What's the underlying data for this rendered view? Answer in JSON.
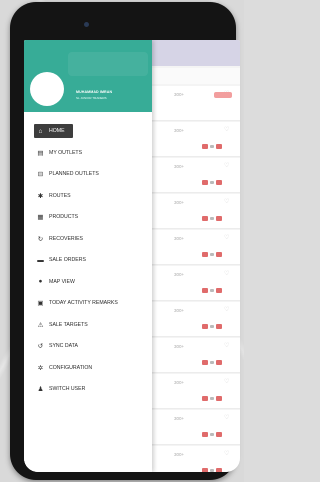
{
  "user": {
    "name": "MUHAMMAD IMRAN",
    "role": "SL JUNIOR TRADERS"
  },
  "menu": [
    {
      "label": "HOME",
      "icon": "home-icon",
      "glyph": "⌂",
      "active": true
    },
    {
      "label": "MY OUTLETS",
      "icon": "store-icon",
      "glyph": "▤",
      "active": false
    },
    {
      "label": "PLANNED OUTLETS",
      "icon": "car-icon",
      "glyph": "⊟",
      "active": false
    },
    {
      "label": "ROUTES",
      "icon": "routes-icon",
      "glyph": "✱",
      "active": false
    },
    {
      "label": "PRODUCTS",
      "icon": "box-icon",
      "glyph": "▦",
      "active": false
    },
    {
      "label": "RECOVERIES",
      "icon": "refresh-icon",
      "glyph": "↻",
      "active": false
    },
    {
      "label": "SALE ORDERS",
      "icon": "list-icon",
      "glyph": "▬",
      "active": false
    },
    {
      "label": "MAP VIEW",
      "icon": "map-pin-icon",
      "glyph": "●",
      "active": false
    },
    {
      "label": "TODAY ACTIVITY REMARKS",
      "icon": "clipboard-icon",
      "glyph": "▣",
      "active": false
    },
    {
      "label": "SALE TARGETS",
      "icon": "target-icon",
      "glyph": "⚠",
      "active": false
    },
    {
      "label": "SYNC DATA",
      "icon": "sync-icon",
      "glyph": "↺",
      "active": false
    },
    {
      "label": "CONFIGURATION",
      "icon": "gear-icon",
      "glyph": "✲",
      "active": false
    },
    {
      "label": "SWITCH USER",
      "icon": "user-icon",
      "glyph": "♟",
      "active": false
    }
  ],
  "background_rows": [
    {
      "amount": "300+",
      "badge": "pink"
    },
    {
      "amount": "300+",
      "badge": "tags"
    },
    {
      "amount": "300+",
      "badge": "tags"
    },
    {
      "amount": "300+",
      "badge": "tags"
    },
    {
      "amount": "300+",
      "badge": "tags"
    },
    {
      "amount": "300+",
      "badge": "tags"
    },
    {
      "amount": "300+",
      "badge": "tags"
    },
    {
      "amount": "300+",
      "badge": "tags"
    },
    {
      "amount": "300+",
      "badge": "tags"
    },
    {
      "amount": "300+",
      "badge": "tags"
    },
    {
      "amount": "300+",
      "badge": "tags"
    }
  ],
  "colors": {
    "drawer_header": "#37ac97",
    "active_item_bg": "#3d3d3d",
    "app_header": "#d6d4e6"
  }
}
